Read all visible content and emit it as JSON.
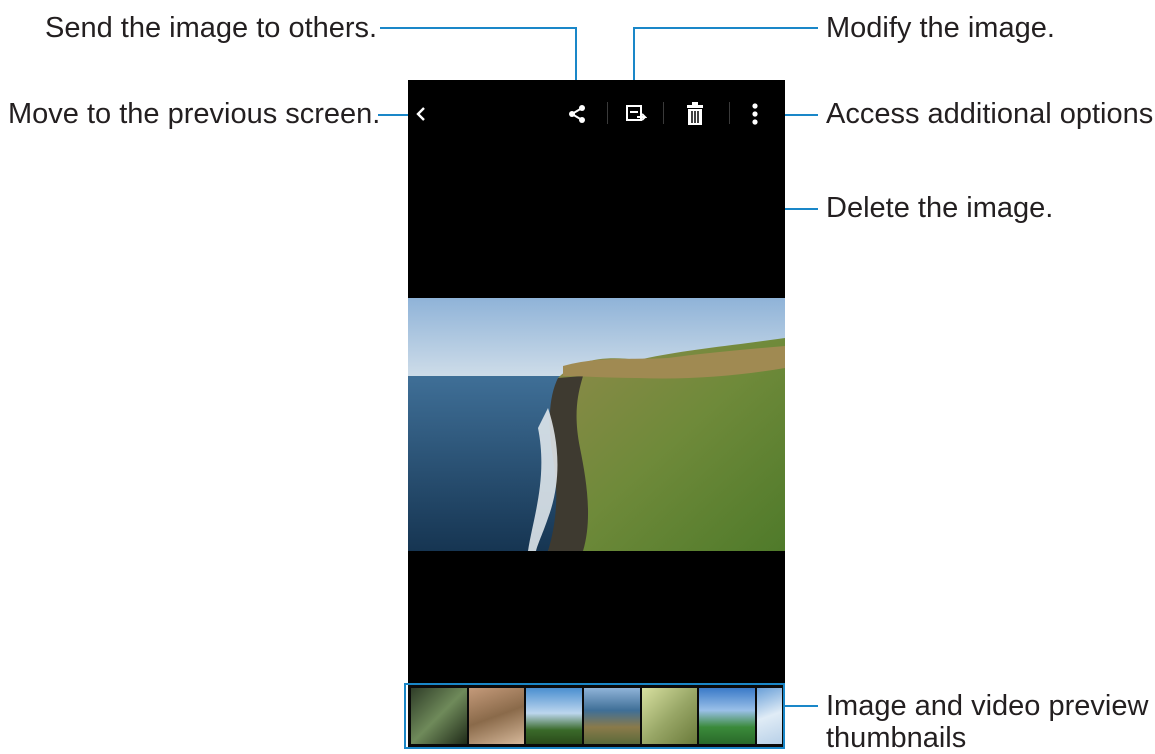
{
  "annotations": {
    "share": "Send the image to others.",
    "edit": "Modify the image.",
    "back": "Move to the previous screen.",
    "more": "Access additional options.",
    "delete": "Delete the image.",
    "thumbnails_line1": "Image and video preview",
    "thumbnails_line2": "thumbnails"
  },
  "toolbar": {
    "icons": [
      "back-icon",
      "share-icon",
      "edit-icon",
      "delete-icon",
      "more-options-icon"
    ]
  },
  "viewer": {
    "image_subject": "coastal cliff with ocean and grassy plateau"
  },
  "thumbnails": [
    "thumb-1",
    "thumb-2",
    "thumb-3",
    "thumb-4",
    "thumb-5",
    "thumb-6",
    "thumb-7"
  ],
  "colors": {
    "accent": "#1a87c8",
    "screen_bg": "#000000",
    "text": "#231f20"
  }
}
